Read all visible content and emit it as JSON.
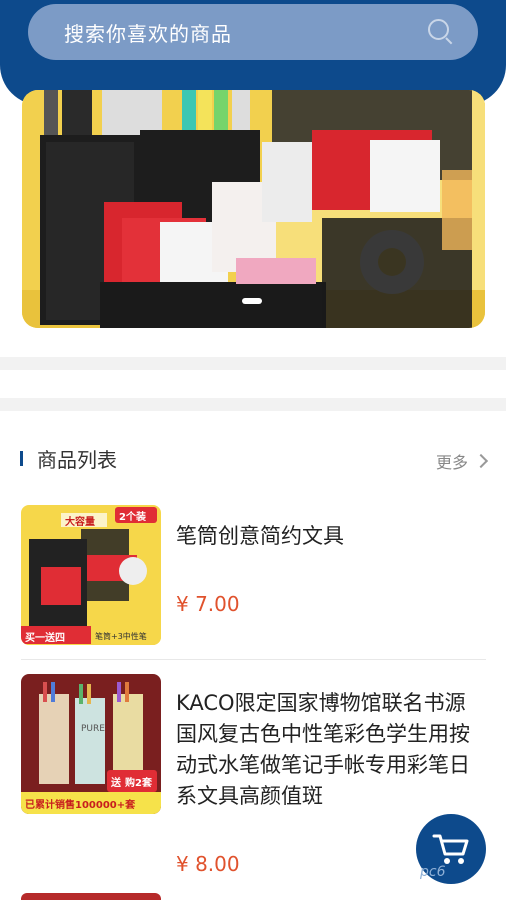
{
  "search": {
    "placeholder": "搜索你喜欢的商品",
    "icon": "search-icon"
  },
  "banner": {
    "image": "desk-organizer-photo",
    "indicator": "slide-indicator"
  },
  "section": {
    "title": "商品列表",
    "more_label": "更多"
  },
  "products": [
    {
      "name": "笔筒创意简约文具",
      "price": "¥ 7.00",
      "thumb": {
        "badge": "大容量",
        "corner": "2个装",
        "promo": "买一送四",
        "sub": "笔筒+3中性笔"
      }
    },
    {
      "name": "KACO限定国家博物馆联名书源国风复古色中性笔彩色学生用按动式水笔做笔记手帐专用彩笔日系文具高颜值斑",
      "price": "¥ 8.00",
      "thumb": {
        "badge": "送",
        "corner": "购2套",
        "promo": "已累计销售100000+套",
        "sub": "PURE"
      }
    }
  ],
  "fab": {
    "icon": "cart-icon"
  },
  "watermark": "pc6"
}
